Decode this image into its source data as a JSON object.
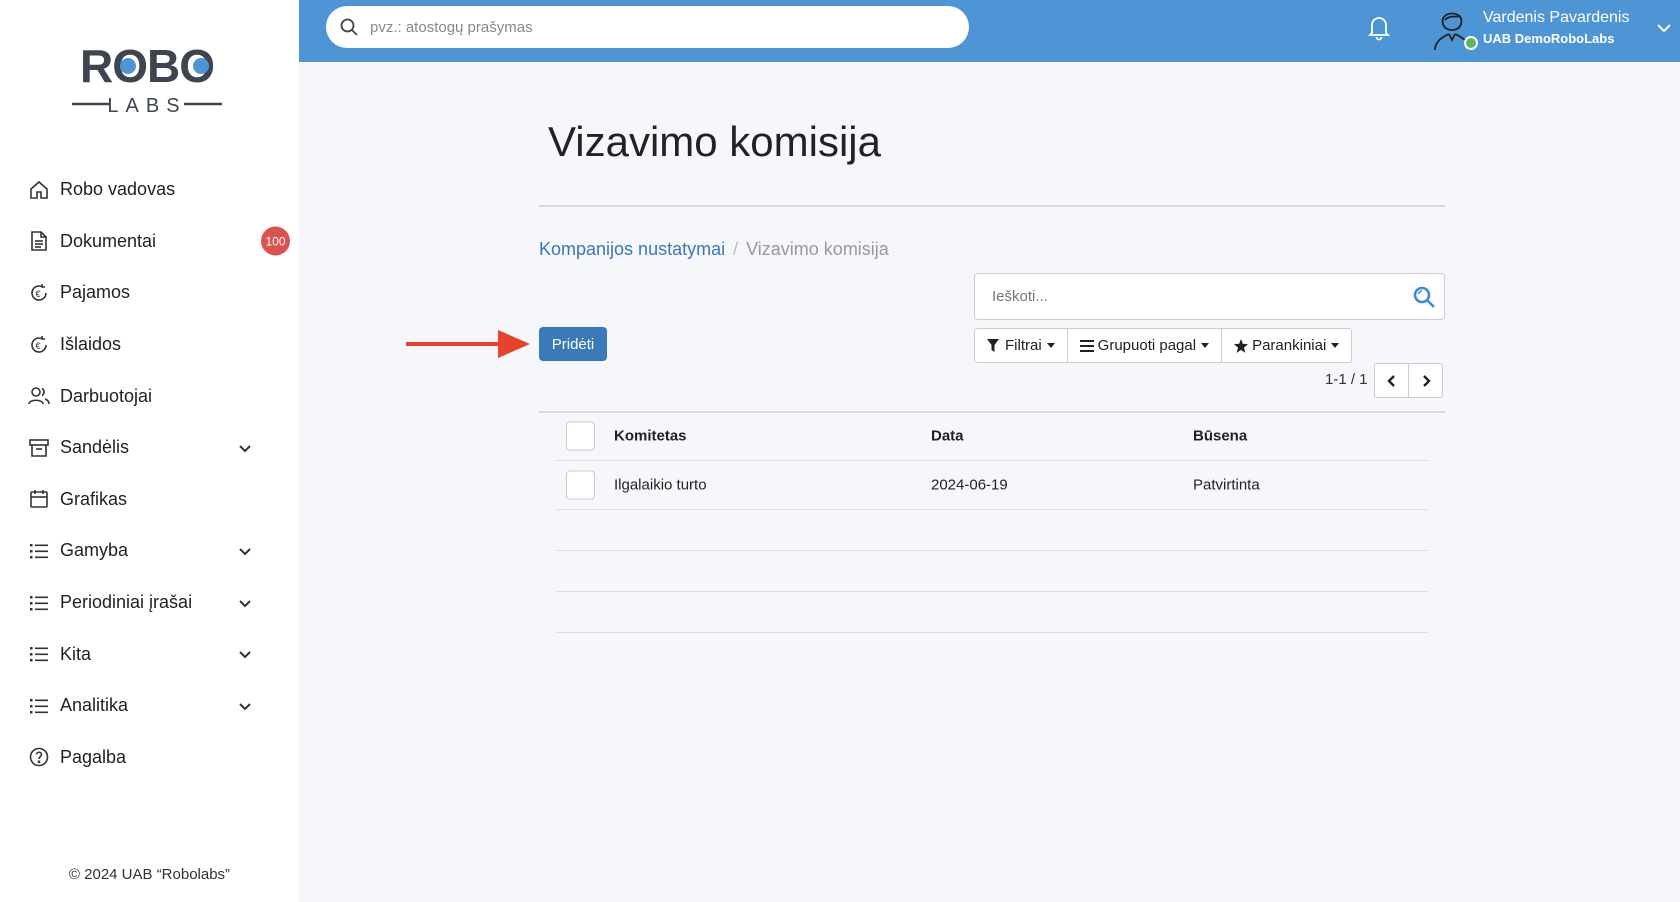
{
  "sidebar": {
    "logo": {
      "top_text": "ROBO",
      "bottom_text": "LABS"
    },
    "items": [
      {
        "label": "Robo vadovas",
        "icon": "home-icon",
        "expandable": false
      },
      {
        "label": "Dokumentai",
        "icon": "document-icon",
        "expandable": false,
        "badge": "100"
      },
      {
        "label": "Pajamos",
        "icon": "euro-refresh-icon",
        "expandable": false
      },
      {
        "label": "Išlaidos",
        "icon": "euro-refresh-icon",
        "expandable": false
      },
      {
        "label": "Darbuotojai",
        "icon": "users-icon",
        "expandable": false
      },
      {
        "label": "Sandėlis",
        "icon": "archive-icon",
        "expandable": true
      },
      {
        "label": "Grafikas",
        "icon": "calendar-icon",
        "expandable": false
      },
      {
        "label": "Gamyba",
        "icon": "list-icon",
        "expandable": true
      },
      {
        "label": "Periodiniai įrašai",
        "icon": "list-icon",
        "expandable": true
      },
      {
        "label": "Kita",
        "icon": "list-icon",
        "expandable": true
      },
      {
        "label": "Analitika",
        "icon": "list-icon",
        "expandable": true
      },
      {
        "label": "Pagalba",
        "icon": "help-icon",
        "expandable": false
      }
    ],
    "copyright": "© 2024 UAB “Robolabs”"
  },
  "topbar": {
    "search_placeholder": "pvz.: atostogų prašymas",
    "user_name": "Vardenis Pavardenis",
    "user_company": "UAB DemoRoboLabs",
    "color": "#4e95d6"
  },
  "page": {
    "title": "Vizavimo komisija",
    "breadcrumb": {
      "parent": "Kompanijos nustatymai",
      "separator": "/",
      "current": "Vizavimo komisija"
    },
    "search_placeholder": "Ieškoti...",
    "add_button": "Pridėti",
    "filters": {
      "filter_label": "Filtrai",
      "group_label": "Grupuoti pagal",
      "favorites_label": "Parankiniai"
    },
    "pager": {
      "text": "1-1 / 1"
    }
  },
  "table": {
    "columns": [
      "Komitetas",
      "Data",
      "Būsena"
    ],
    "rows": [
      {
        "committee": "Ilgalaikio turto",
        "date": "2024-06-19",
        "status": "Patvirtinta"
      }
    ]
  },
  "colors": {
    "accent": "#3b7ab8",
    "badge": "#d9534f",
    "arrow": "#e8412c",
    "online": "#5cb85c"
  }
}
